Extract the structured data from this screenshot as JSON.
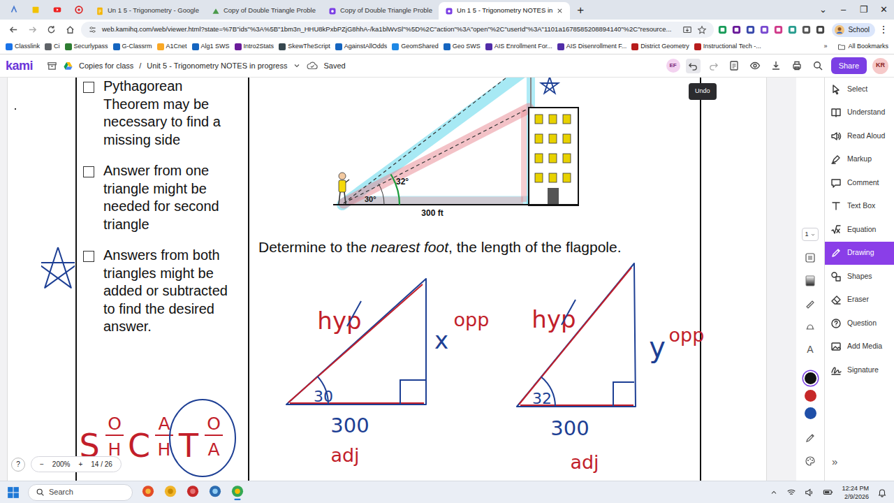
{
  "browser": {
    "tabs": [
      {
        "label": "Un 1 5 - Trigonometry - Google",
        "selected": false
      },
      {
        "label": "Copy of Double Triangle Proble",
        "selected": false
      },
      {
        "label": "Copy of Double Triangle Proble",
        "selected": false
      },
      {
        "label": "Un 1 5 - Trigonometry NOTES in",
        "selected": true
      }
    ],
    "new_tab": "+",
    "window_controls": [
      "⌄",
      "–",
      "❐",
      "✕"
    ],
    "url": "web.kamihq.com/web/viewer.html?state=%7B\"ids\"%3A%5B\"1bm3n_HHU8kPxbPZjG8hhA-/ka1blWvSl\"%5D%2C\"action\"%3A\"open\"%2C\"userId\"%3A\"1101a1678585208894140\"%2C\"resource...",
    "profile": "School",
    "menu": "⋮",
    "bookmarks": [
      "Classlink",
      "Ci",
      "Securlypass",
      "G-Classrm",
      "A1Cnet",
      "Alg1 SWS",
      "Intro2Stats",
      "SkewTheScript",
      "AgainstAllOdds",
      "GeomShared",
      "Geo SWS",
      "AIS Enrollment For...",
      "AIS Disenrollment F...",
      "District Geometry",
      "Instructional Tech -..."
    ],
    "bookmarks_more": "»",
    "all_bookmarks": "All Bookmarks"
  },
  "kami": {
    "logo": "kami",
    "folder": "Copies for class",
    "separator": "/",
    "document": "Unit 5 - Trigonometry NOTES in progress",
    "status": "Saved",
    "collaborator": "EF",
    "share": "Share",
    "user": "KR"
  },
  "tooltip": "Undo",
  "worksheet": {
    "checklist": [
      {
        "text": "Pythagorean Theorem may be necessary to find a missing side",
        "checked": false
      },
      {
        "text": "Answer from one triangle might be needed for second triangle",
        "checked": false
      },
      {
        "text": "Answers from both triangles might be added or subtracted to find the desired answer.",
        "checked": false
      }
    ],
    "mnemonic": [
      {
        "letter": "S",
        "top": "O",
        "bottom": "H",
        "circled": false
      },
      {
        "letter": "C",
        "top": "A",
        "bottom": "H",
        "circled": false
      },
      {
        "letter": "T",
        "top": "O",
        "bottom": "A",
        "circled": true
      }
    ],
    "figure": {
      "angle_top": "32°",
      "angle_bottom": "30°",
      "distance": "300 ft"
    },
    "question": {
      "before": "Determine to the ",
      "emphasis": "nearest foot",
      "after": ", the length of the flagpole."
    },
    "triangles": [
      {
        "hyp": "hyp",
        "crossed_out": true,
        "side": "x",
        "side_label": "opp",
        "angle": "30",
        "base": "300",
        "base_label": "adj"
      },
      {
        "hyp": "hyp",
        "crossed_out": true,
        "side": "y",
        "side_label": "opp",
        "angle": "32",
        "base": "300",
        "base_label": "adj"
      }
    ]
  },
  "tools": {
    "page": "1",
    "text_glyph": "A",
    "colors": [
      {
        "color": "#111111",
        "selected": true
      },
      {
        "color": "#c62828",
        "selected": false
      },
      {
        "color": "#1f4fa8",
        "selected": false
      }
    ],
    "items": [
      {
        "label": "Select",
        "selected": false
      },
      {
        "label": "Understand",
        "selected": false
      },
      {
        "label": "Read Aloud",
        "selected": false
      },
      {
        "label": "Markup",
        "selected": false
      },
      {
        "label": "Comment",
        "selected": false
      },
      {
        "label": "Text Box",
        "selected": false
      },
      {
        "label": "Equation",
        "selected": false
      },
      {
        "label": "Drawing",
        "selected": true
      },
      {
        "label": "Shapes",
        "selected": false
      },
      {
        "label": "Eraser",
        "selected": false
      },
      {
        "label": "Question",
        "selected": false
      },
      {
        "label": "Add Media",
        "selected": false
      },
      {
        "label": "Signature",
        "selected": false
      }
    ],
    "collapse": "»"
  },
  "zoom": {
    "help": "?",
    "minus": "−",
    "level": "200%",
    "plus": "+",
    "pages": "14 / 26"
  },
  "taskbar": {
    "search": "Search",
    "time": "12:24 PM",
    "date": "2/9/2026"
  }
}
